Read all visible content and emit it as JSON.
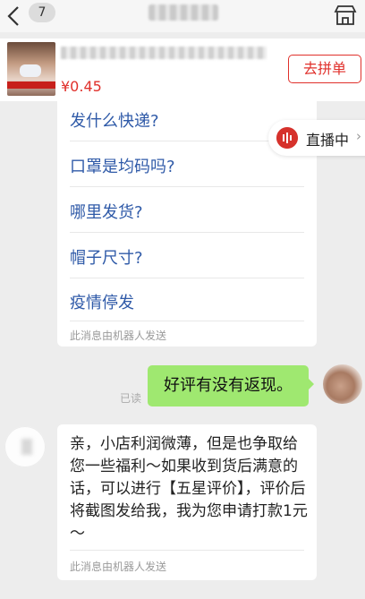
{
  "header": {
    "unread_count": "7"
  },
  "product": {
    "price": "¥0.45",
    "group_buy_label": "去拼单"
  },
  "faq": {
    "questions": [
      "发什么快递?",
      "口罩是均码吗?",
      "哪里发货?",
      "帽子尺寸?",
      "疫情停发"
    ],
    "robot_note": "此消息由机器人发送"
  },
  "live": {
    "label": "直播中",
    "chevron": "›"
  },
  "my_message": {
    "text": "好评有没有返现。",
    "read_status": "已读"
  },
  "bot_reply": {
    "text": "亲，小店利润微薄，但是也争取给您一些福利～如果收到货后满意的话，可以进行【五星评价】，评价后将截图发给我，我为您申请打款1元～",
    "robot_note": "此消息由机器人发送"
  },
  "colors": {
    "accent_red": "#e0302b",
    "link_blue": "#2f5aa8",
    "bubble_green": "#9fe870"
  }
}
